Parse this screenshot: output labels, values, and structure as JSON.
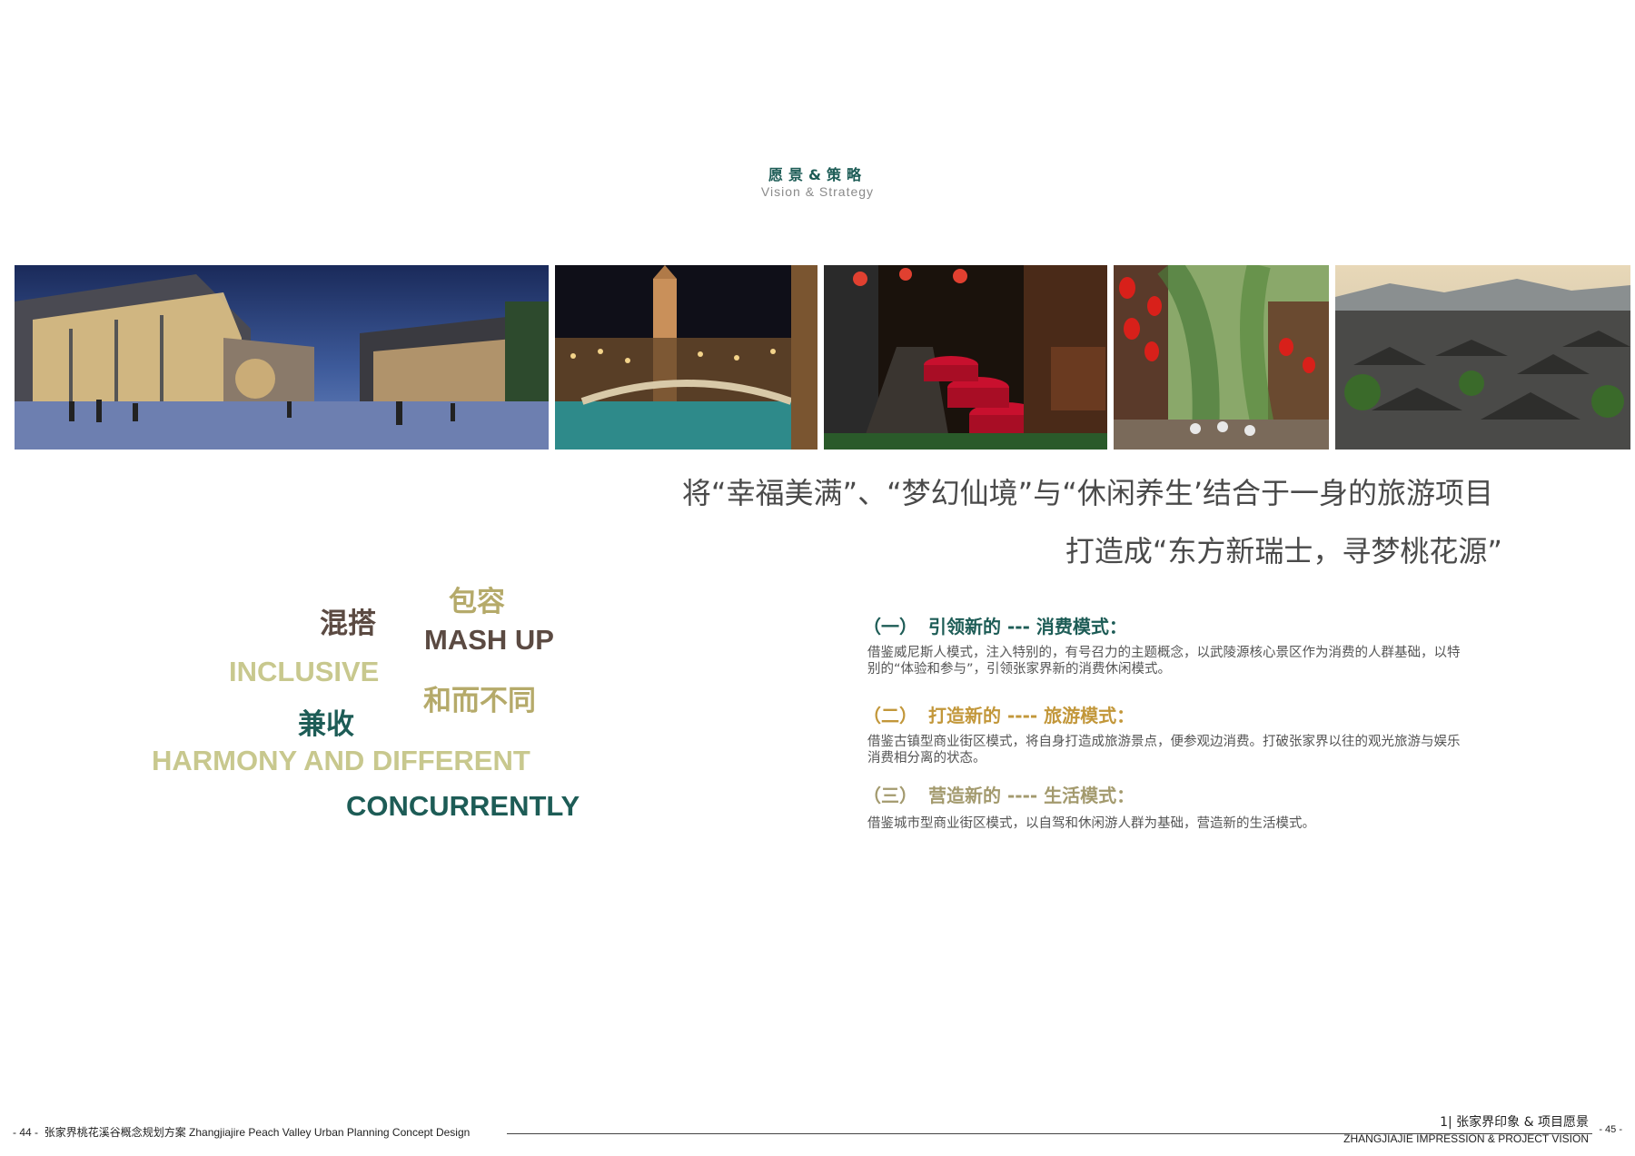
{
  "header": {
    "title_cn": "愿景&策略",
    "title_en": "Vision & Strategy"
  },
  "photos": [
    {
      "icon": "night-shopping-plaza-photo"
    },
    {
      "icon": "venetian-canal-night-photo"
    },
    {
      "icon": "lantern-dining-street-photo"
    },
    {
      "icon": "red-lantern-ancient-street-photo"
    },
    {
      "icon": "old-town-rooftops-photo"
    }
  ],
  "slogan": {
    "line1": "将“幸福美满”、“梦幻仙境”与“休闲养生’结合于一身的旅游项目",
    "line2": "打造成“东方新瑞士，寻梦桃花源”"
  },
  "word_cloud": {
    "hunda": "混搭",
    "baorong": "包容",
    "mash_up": "MASH UP",
    "inclusive": "INCLUSIVE",
    "he_er_bu_tong": "和而不同",
    "jianshou": "兼收",
    "harmony": "HARMONY AND DIFFERENT",
    "concurrently": "CONCURRENTLY",
    "colors": {
      "brown": "#5b4a42",
      "olive": "#b5aa6a",
      "pale_olive": "#c8c88e",
      "teal": "#1d5c56"
    }
  },
  "strategies": [
    {
      "num": "（一）",
      "title": "引领新的 --- 消费模式：",
      "desc": "借鉴威尼斯人模式，注入特别的，有号召力的主题概念，以武陵源核心景区作为消费的人群基础，以特别的“体验和参与”，引领张家界新的消费休闲模式。",
      "color": "#1d5c56"
    },
    {
      "num": "（二）",
      "title": "打造新的 ---- 旅游模式：",
      "desc": "借鉴古镇型商业街区模式，将自身打造成旅游景点，便参观边消费。打破张家界以往的观光旅游与娱乐消费相分离的状态。",
      "color": "#c2973a"
    },
    {
      "num": "（三）",
      "title": "营造新的 ---- 生活模式：",
      "desc": "借鉴城市型商业街区模式，以自驾和休闲游人群为基础，营造新的生活模式。",
      "color": "#a39a6e"
    }
  ],
  "footer": {
    "left_page": "- 44 -",
    "left_title": "张家界桃花溪谷概念规划方案 Zhangjiajire Peach Valley Urban Planning Concept Design",
    "right_section_cn": "1| 张家界印象 & 项目愿景",
    "right_section_en": "ZHANGJIAJIE IMPRESSION & PROJECT  VISION",
    "right_page": "- 45 -"
  }
}
